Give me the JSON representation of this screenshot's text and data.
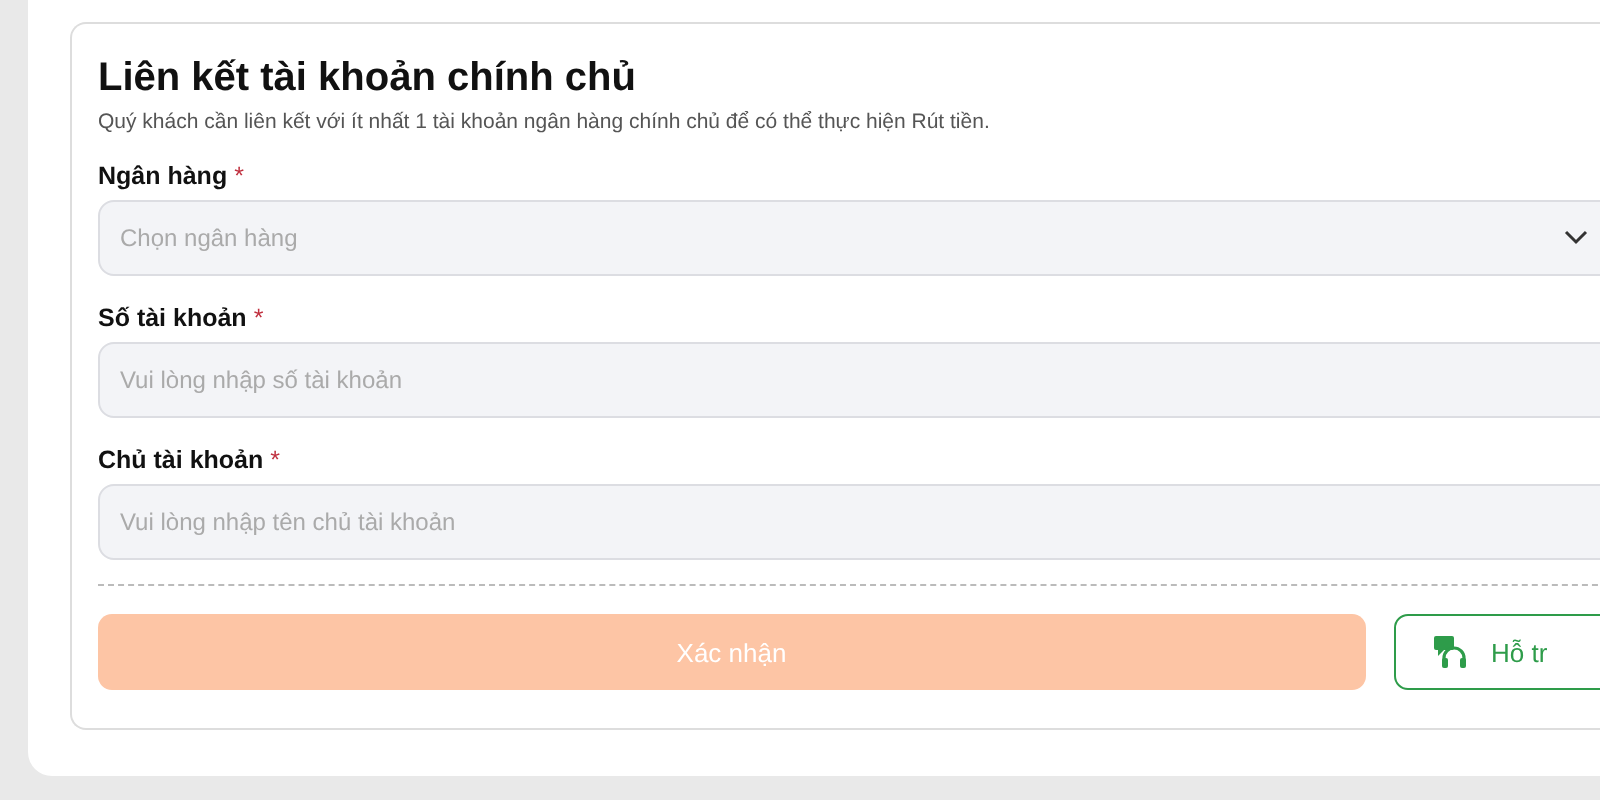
{
  "form": {
    "title": "Liên kết tài khoản chính chủ",
    "subtitle": "Quý khách cần liên kết với ít nhất 1 tài khoản ngân hàng chính chủ để có thể thực hiện Rút tiền.",
    "fields": [
      {
        "kind": "select",
        "label": "Ngân hàng",
        "required_mark": "*",
        "placeholder": "Chọn ngân hàng"
      },
      {
        "kind": "text",
        "label": "Số tài khoản",
        "required_mark": "*",
        "placeholder": "Vui lòng nhập số tài khoản"
      },
      {
        "kind": "text",
        "label": "Chủ tài khoản",
        "required_mark": "*",
        "placeholder": "Vui lòng nhập tên chủ tài khoản"
      }
    ],
    "confirm_button": {
      "label": "Xác nhận",
      "disabled": true
    },
    "support_button": {
      "label": "Hỗ tr"
    }
  }
}
